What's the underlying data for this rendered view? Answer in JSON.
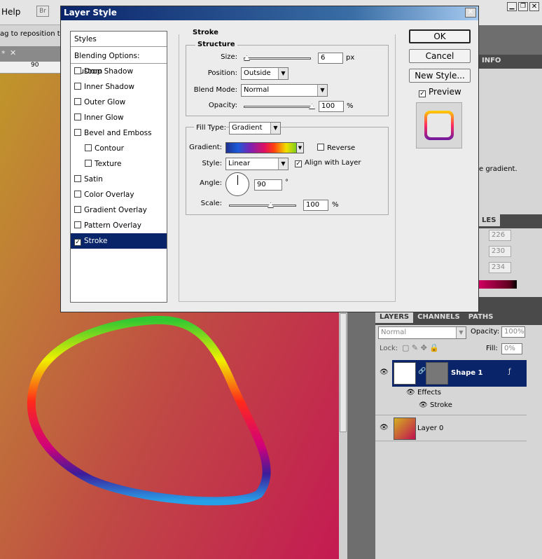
{
  "app": {
    "menu": {
      "help": "Help",
      "br": "Br"
    },
    "options_hint": "ag to reposition the",
    "ruler_mark": "90"
  },
  "dialog": {
    "title": "Layer Style",
    "styles_header": "Styles",
    "blending": "Blending Options: Custom",
    "styles": [
      {
        "label": "Drop Shadow",
        "checked": false
      },
      {
        "label": "Inner Shadow",
        "checked": false
      },
      {
        "label": "Outer Glow",
        "checked": false
      },
      {
        "label": "Inner Glow",
        "checked": false
      },
      {
        "label": "Bevel and Emboss",
        "checked": false
      },
      {
        "label": "Contour",
        "checked": false
      },
      {
        "label": "Texture",
        "checked": false
      },
      {
        "label": "Satin",
        "checked": false
      },
      {
        "label": "Color Overlay",
        "checked": false
      },
      {
        "label": "Gradient Overlay",
        "checked": false
      },
      {
        "label": "Pattern Overlay",
        "checked": false
      },
      {
        "label": "Stroke",
        "checked": true
      }
    ],
    "buttons": {
      "ok": "OK",
      "cancel": "Cancel",
      "new_style": "New Style..."
    },
    "preview": {
      "label": "Preview",
      "checked": true
    },
    "stroke": {
      "title": "Stroke",
      "structure": "Structure",
      "size_label": "Size:",
      "size_value": "6",
      "size_unit": "px",
      "position_label": "Position:",
      "position_value": "Outside",
      "blend_label": "Blend Mode:",
      "blend_value": "Normal",
      "opacity_label": "Opacity:",
      "opacity_value": "100",
      "opacity_unit": "%",
      "fill_type_label": "Fill Type:",
      "fill_type_value": "Gradient",
      "gradient_label": "Gradient:",
      "reverse_label": "Reverse",
      "style_label": "Style:",
      "style_value": "Linear",
      "align_label": "Align with Layer",
      "angle_label": "Angle:",
      "angle_value": "90",
      "angle_unit": "°",
      "scale_label": "Scale:",
      "scale_value": "100",
      "scale_unit": "%"
    }
  },
  "panels": {
    "info_tab": "INFO",
    "info_text": "e gradient.",
    "styles_tab_frag": "LES",
    "color_values": [
      "226",
      "230",
      "234"
    ],
    "layers_tabs": [
      "LAYERS",
      "CHANNELS",
      "PATHS"
    ],
    "blend_mode": "Normal",
    "opacity_label": "Opacity:",
    "opacity_value": "100%",
    "lock_label": "Lock:",
    "fill_label": "Fill:",
    "fill_value": "0%",
    "layers": {
      "shape": "Shape 1",
      "effects": "Effects",
      "stroke": "Stroke",
      "layer0": "Layer 0"
    }
  }
}
